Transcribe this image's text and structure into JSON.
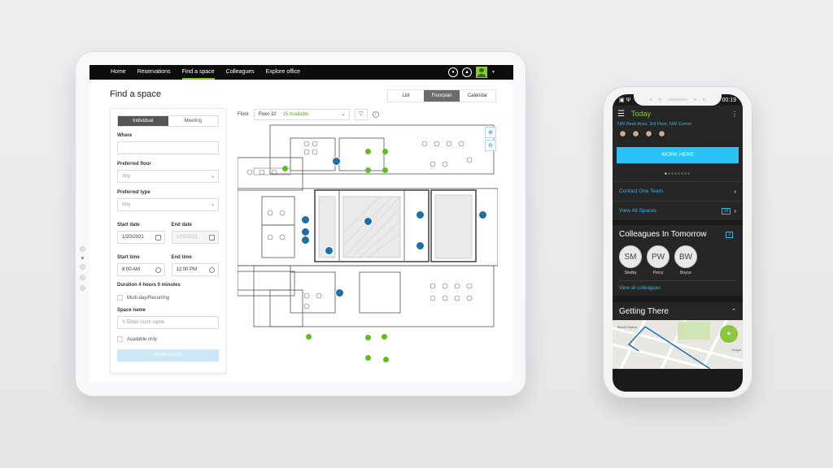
{
  "tablet": {
    "nav": {
      "items": [
        {
          "label": "Home"
        },
        {
          "label": "Reservations"
        },
        {
          "label": "Find a space",
          "active": true
        },
        {
          "label": "Colleagues"
        },
        {
          "label": "Explore office"
        }
      ],
      "icons": [
        "user-circle-icon",
        "bell-icon",
        "avatar",
        "chevron-down-icon"
      ]
    },
    "page_title": "Find a space",
    "view_toggle": [
      "List",
      "Floorplan",
      "Calendar"
    ],
    "view_active": "Floorplan",
    "filters": {
      "segments": [
        "Individual",
        "Meeting"
      ],
      "segment_active": "Individual",
      "where_label": "Where",
      "where_value": "",
      "preferred_floor_label": "Preferred floor",
      "preferred_floor_value": "Any",
      "preferred_type_label": "Preferred type",
      "preferred_type_value": "Any",
      "start_date_label": "Start date",
      "start_date_value": "1/20/2021",
      "end_date_label": "End date",
      "end_date_value": "1/20/2021",
      "start_time_label": "Start time",
      "start_time_value": "8:00 AM",
      "end_time_label": "End time",
      "end_time_value": "12:00 PM",
      "duration": "Duration 4 hours 0 minutes",
      "multiday_label": "Multi-day/Recurring",
      "space_name_label": "Space name",
      "space_name_placeholder": "Enter room name",
      "available_only_label": "Available only",
      "show_results": "Show results"
    },
    "floor_bar": {
      "label": "Floor",
      "floor_value": "Floor 32",
      "available": "15 Available"
    }
  },
  "phone": {
    "status_time": "00:19",
    "header_title": "Today",
    "location": "NW Desk Area, 3rd Floor, NW Corner",
    "work_here": "WORK HERE",
    "links": [
      {
        "label": "Contact One Team"
      },
      {
        "label": "View All Spaces",
        "badge": "28"
      }
    ],
    "colleagues": {
      "title": "Colleagues In Tomorrow",
      "count": "3",
      "people": [
        {
          "initials": "SM",
          "name": "Shelby"
        },
        {
          "initials": "PW",
          "name": "Percy"
        },
        {
          "initials": "BW",
          "name": "Boyce"
        }
      ],
      "view_all": "View all colleagues"
    },
    "getting_there": {
      "title": "Getting There",
      "map_labels": [
        "Mood Fabrics",
        "Chrysl"
      ],
      "fab": "+"
    }
  },
  "colors": {
    "accent_green": "#8cc63f",
    "link_blue": "#39b4e6",
    "button_blue": "#29c3f6",
    "pin_blue": "#1d6fa5"
  }
}
